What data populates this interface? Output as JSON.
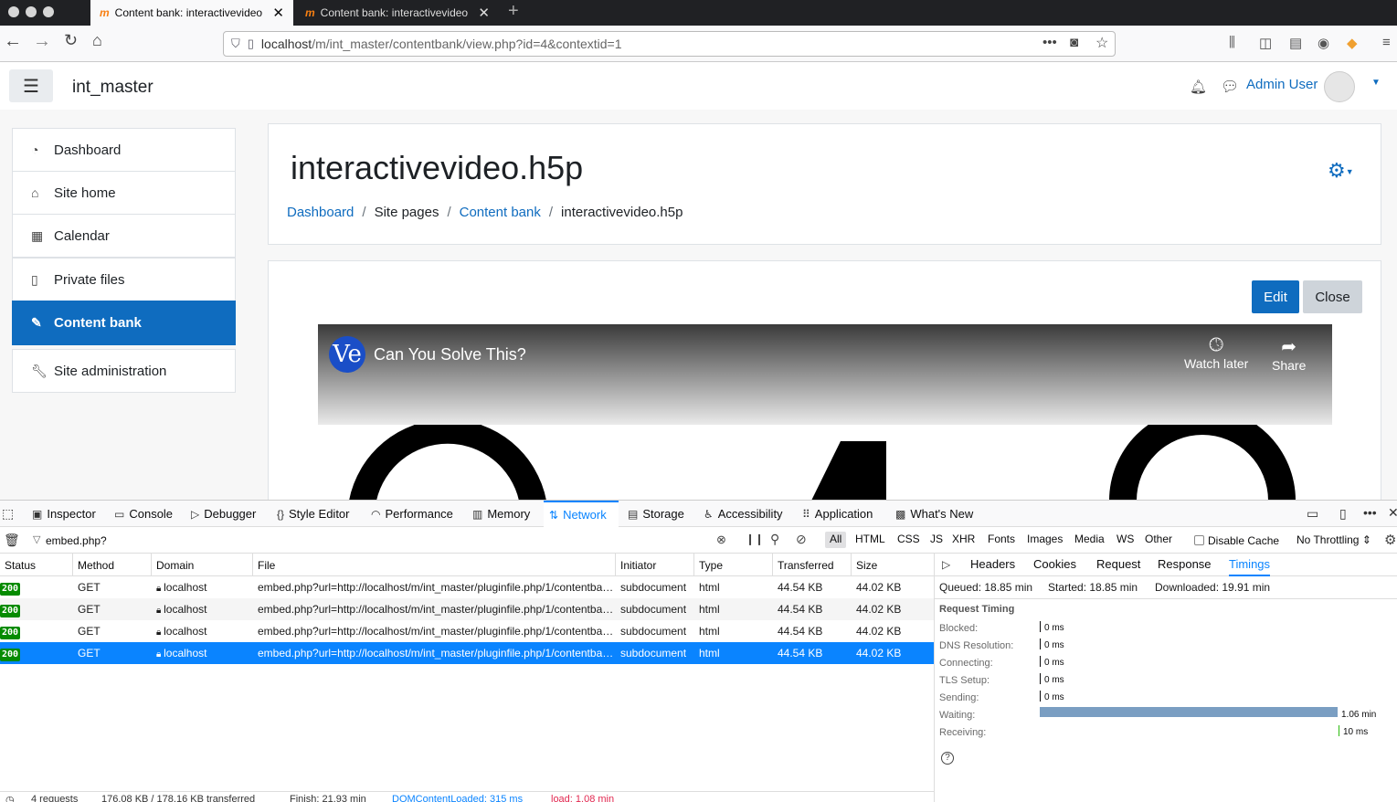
{
  "browser": {
    "tabs": [
      {
        "title": "Content bank: interactivevideo.h5p"
      },
      {
        "title": "Content bank: interactivevideo.h5p"
      }
    ],
    "url": {
      "host": "localhost",
      "path": "/m/int_master/contentbank/view.php?id=4&contextid=1"
    }
  },
  "header": {
    "site_name": "int_master",
    "user_name": "Admin User"
  },
  "sidebar": {
    "items": [
      {
        "label": "Dashboard",
        "icon": "dashboard-icon"
      },
      {
        "label": "Site home",
        "icon": "home-icon"
      },
      {
        "label": "Calendar",
        "icon": "calendar-icon"
      },
      {
        "label": "Private files",
        "icon": "file-icon"
      },
      {
        "label": "Content bank",
        "icon": "brush-icon",
        "selected": true
      },
      {
        "label": "Site administration",
        "icon": "wrench-icon"
      }
    ]
  },
  "main": {
    "title": "interactivevideo.h5p",
    "breadcrumb": [
      "Dashboard",
      "Site pages",
      "Content bank",
      "interactivevideo.h5p"
    ],
    "edit_label": "Edit",
    "close_label": "Close"
  },
  "video": {
    "logo": "Ve",
    "title": "Can You Solve This?",
    "watch_later": "Watch later",
    "share": "Share"
  },
  "devtools": {
    "tabs": [
      "Inspector",
      "Console",
      "Debugger",
      "Style Editor",
      "Performance",
      "Memory",
      "Network",
      "Storage",
      "Accessibility",
      "Application",
      "What's New"
    ],
    "active_tab": "Network",
    "filter_value": "embed.php?",
    "type_filters": [
      "All",
      "HTML",
      "CSS",
      "JS",
      "XHR",
      "Fonts",
      "Images",
      "Media",
      "WS",
      "Other"
    ],
    "disable_cache": "Disable Cache",
    "throttling": "No Throttling ⇕",
    "columns": [
      "Status",
      "Method",
      "Domain",
      "File",
      "Initiator",
      "Type",
      "Transferred",
      "Size"
    ],
    "requests": [
      {
        "status": "200",
        "method": "GET",
        "domain": "localhost",
        "file": "embed.php?url=http://localhost/m/int_master/pluginfile.php/1/contentba…",
        "initiator": "subdocument",
        "type": "html",
        "transferred": "44.54 KB",
        "size": "44.02 KB"
      },
      {
        "status": "200",
        "method": "GET",
        "domain": "localhost",
        "file": "embed.php?url=http://localhost/m/int_master/pluginfile.php/1/contentba…",
        "initiator": "subdocument",
        "type": "html",
        "transferred": "44.54 KB",
        "size": "44.02 KB"
      },
      {
        "status": "200",
        "method": "GET",
        "domain": "localhost",
        "file": "embed.php?url=http://localhost/m/int_master/pluginfile.php/1/contentba…",
        "initiator": "subdocument",
        "type": "html",
        "transferred": "44.54 KB",
        "size": "44.02 KB"
      },
      {
        "status": "200",
        "method": "GET",
        "domain": "localhost",
        "file": "embed.php?url=http://localhost/m/int_master/pluginfile.php/1/contentba…",
        "initiator": "subdocument",
        "type": "html",
        "transferred": "44.54 KB",
        "size": "44.02 KB",
        "selected": true
      }
    ],
    "statusbar": {
      "requests": "4 requests",
      "transferred": "176.08 KB / 178.16 KB transferred",
      "finish": "Finish: 21.93 min",
      "dcl": "DOMContentLoaded: 315 ms",
      "load": "load: 1.08 min"
    },
    "side_tabs": [
      "Headers",
      "Cookies",
      "Request",
      "Response",
      "Timings"
    ],
    "active_side_tab": "Timings",
    "timings": {
      "queued": "Queued: 18.85 min",
      "started": "Started: 18.85 min",
      "downloaded": "Downloaded: 19.91 min",
      "heading": "Request Timing",
      "rows": [
        {
          "label": "Blocked:",
          "value": "0 ms",
          "fraction": 0
        },
        {
          "label": "DNS Resolution:",
          "value": "0 ms",
          "fraction": 0
        },
        {
          "label": "Connecting:",
          "value": "0 ms",
          "fraction": 0
        },
        {
          "label": "TLS Setup:",
          "value": "0 ms",
          "fraction": 0
        },
        {
          "label": "Sending:",
          "value": "0 ms",
          "fraction": 0
        },
        {
          "label": "Waiting:",
          "value": "1.06 min",
          "fraction": 0.98
        },
        {
          "label": "Receiving:",
          "value": "10 ms",
          "fraction": 0
        }
      ]
    }
  }
}
